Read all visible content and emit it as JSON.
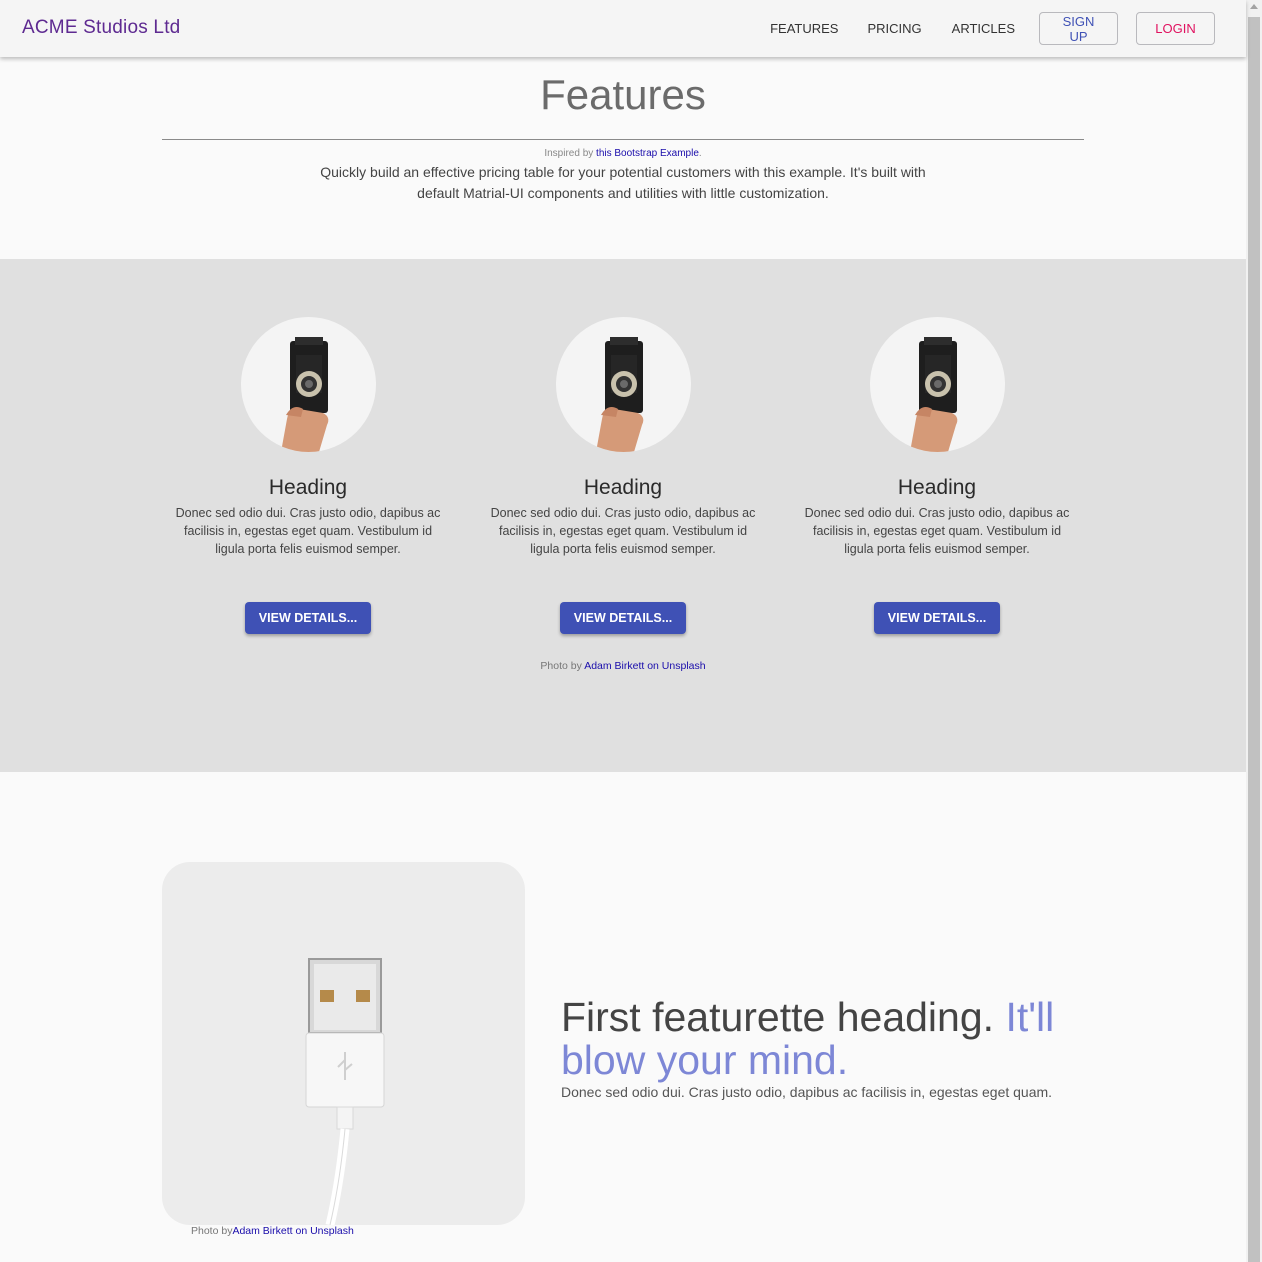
{
  "header": {
    "brand": "ACME Studios Ltd",
    "nav": [
      "FEATURES",
      "PRICING",
      "ARTICLES"
    ],
    "signup_label": "SIGN UP",
    "login_label": "LOGIN"
  },
  "hero": {
    "title": "Features",
    "credit_prefix": "Inspired by",
    "credit_link": "this Bootstrap Example",
    "credit_suffix": ".",
    "description": "Quickly build an effective pricing table for your potential customers with this example. It's built with default Matrial-UI components and utilities with little customization."
  },
  "features": {
    "items": [
      {
        "heading": "Heading",
        "text": "Donec sed odio dui. Cras justo odio, dapibus ac facilisis in, egestas eget quam. Vestibulum id ligula porta felis euismod semper.",
        "button": "VIEW DETAILS..."
      },
      {
        "heading": "Heading",
        "text": "Donec sed odio dui. Cras justo odio, dapibus ac facilisis in, egestas eget quam. Vestibulum id ligula porta felis euismod semper.",
        "button": "VIEW DETAILS..."
      },
      {
        "heading": "Heading",
        "text": "Donec sed odio dui. Cras justo odio, dapibus ac facilisis in, egestas eget quam. Vestibulum id ligula porta felis euismod semper.",
        "button": "VIEW DETAILS..."
      }
    ],
    "credit_prefix": "Photo by",
    "credit_link": "Adam Birkett on Unsplash"
  },
  "featurette": {
    "heading": "First featurette heading.",
    "heading_muted": "It'll blow your mind.",
    "text": "Donec sed odio dui. Cras justo odio, dapibus ac facilisis in, egestas eget quam.",
    "credit_prefix": "Photo by",
    "credit_link": "Adam Birkett on Unsplash"
  },
  "colors": {
    "brand": "#5e2a91",
    "primary": "#3f51b5",
    "login": "#e0115f",
    "features_bg": "#e0e0e0",
    "muted_heading": "#7d87d6"
  }
}
